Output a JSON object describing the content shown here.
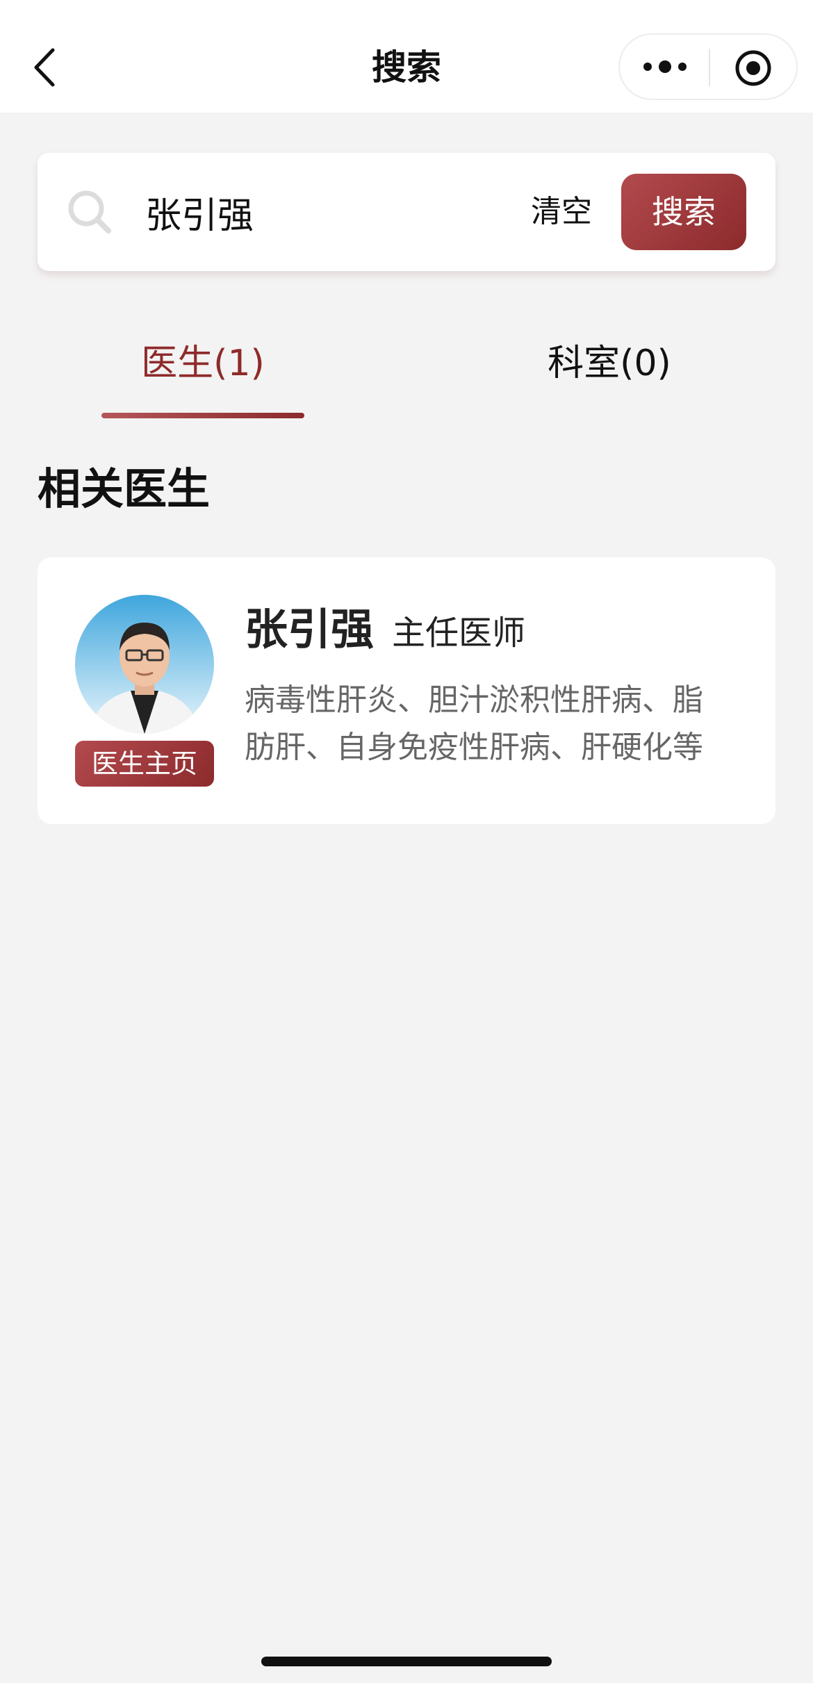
{
  "nav": {
    "title": "搜索"
  },
  "search": {
    "value": "张引强",
    "clear_label": "清空",
    "button_label": "搜索"
  },
  "tabs": [
    {
      "label": "医生(1)",
      "active": true
    },
    {
      "label": "科室(0)",
      "active": false
    }
  ],
  "section_title": "相关医生",
  "doctors": [
    {
      "name": "张引强",
      "title": "主任医师",
      "specialty": "病毒性肝炎、胆汁淤积性肝病、脂肪肝、自身免疫性肝病、肝硬化等",
      "profile_label": "医生主页"
    }
  ],
  "colors": {
    "accent": "#8e2b2a",
    "background": "#f3f3f3"
  }
}
